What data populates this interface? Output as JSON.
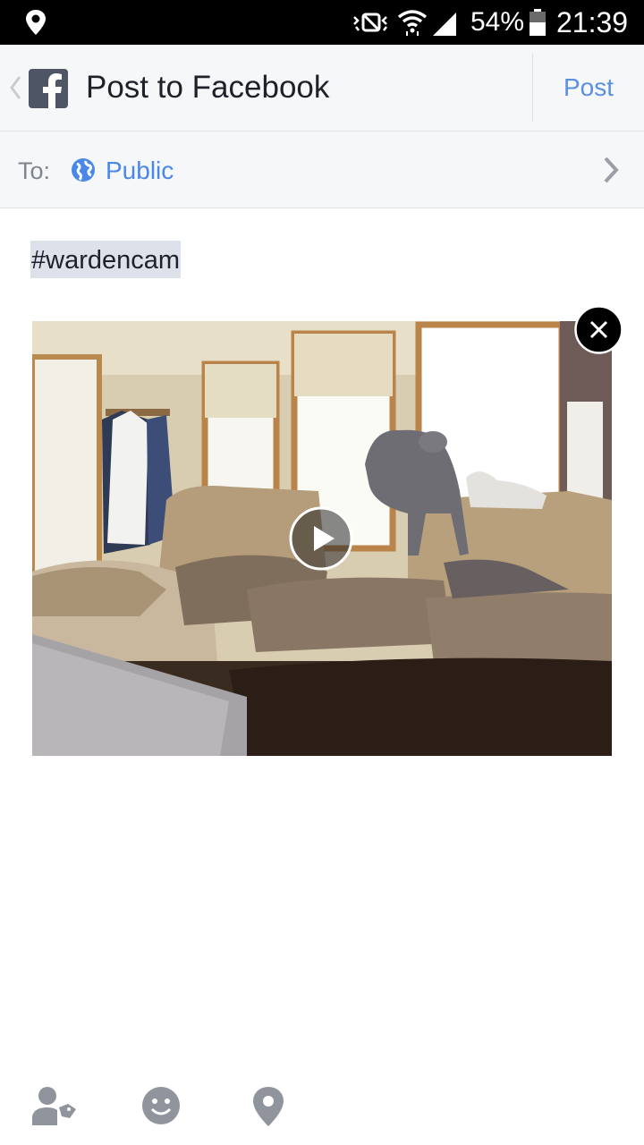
{
  "status_bar": {
    "battery": "54%",
    "time": "21:39",
    "icons": [
      "location-icon",
      "mute-icon",
      "wifi-icon",
      "signal-icon",
      "battery-icon"
    ]
  },
  "header": {
    "title": "Post to Facebook",
    "post_label": "Post"
  },
  "audience": {
    "to_label": "To:",
    "value": "Public"
  },
  "composer": {
    "text": "#wardencam"
  },
  "attachment": {
    "type": "video",
    "icons": [
      "play-icon",
      "close-icon"
    ]
  },
  "toolbar": {
    "icons": [
      "tag-people-icon",
      "feeling-icon",
      "check-in-icon"
    ]
  },
  "colors": {
    "accent": "#4a88e8",
    "status_bar": "#000000",
    "header_bg": "#f6f7f9",
    "toolbar_icon": "#90949c"
  }
}
